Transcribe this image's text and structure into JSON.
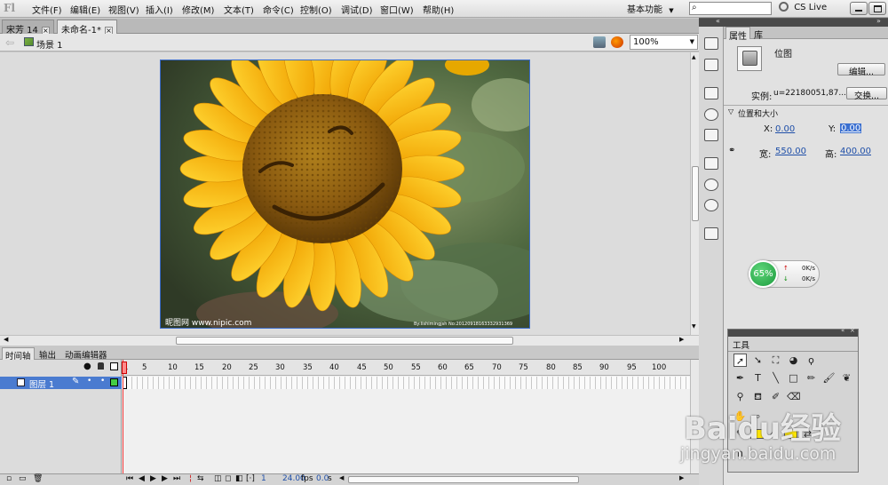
{
  "menu": {
    "items": [
      "文件(F)",
      "编辑(E)",
      "视图(V)",
      "插入(I)",
      "修改(M)",
      "文本(T)",
      "命令(C)",
      "控制(O)",
      "调试(D)",
      "窗口(W)",
      "帮助(H)"
    ],
    "workspace": "基本功能",
    "cs_live": "CS Live"
  },
  "tabs": [
    {
      "label": "宋芳 14"
    },
    {
      "label": "未命名-1*"
    }
  ],
  "scene": {
    "label": "场景 1",
    "zoom": "100%"
  },
  "image": {
    "watermark_left": "昵图网 www.nipic.com",
    "watermark_right": "By:lishimingjsh No:20120918163332931369"
  },
  "timeline": {
    "tabs": [
      "时间轴",
      "输出",
      "动画编辑器"
    ],
    "layer_name": "图层 1",
    "ruler": [
      "1",
      "5",
      "10",
      "15",
      "20",
      "25",
      "30",
      "35",
      "40",
      "45",
      "50",
      "55",
      "60",
      "65",
      "70",
      "75",
      "80",
      "85",
      "90",
      "95",
      "100"
    ],
    "current_frame": "1",
    "fps": "24.00",
    "fps_unit": "fps",
    "time": "0.0",
    "time_unit": "s"
  },
  "properties": {
    "tabs": [
      "属性",
      "库"
    ],
    "type": "位图",
    "edit_button": "编辑...",
    "instance_label": "实例:",
    "instance_value": "u=22180051,87...",
    "swap_button": "交换...",
    "section": "位置和大小",
    "x_label": "X:",
    "x_value": "0.00",
    "y_label": "Y:",
    "y_value": "0.00",
    "w_label": "宽:",
    "w_value": "550.00",
    "h_label": "高:",
    "h_value": "400.00"
  },
  "net_monitor": {
    "percent": "65%",
    "up": "0K/s",
    "down": "0K/s"
  },
  "tools": {
    "title": "工具"
  },
  "baidu": {
    "brand": "Baidu经验",
    "url": "jingyan.baidu.com"
  }
}
